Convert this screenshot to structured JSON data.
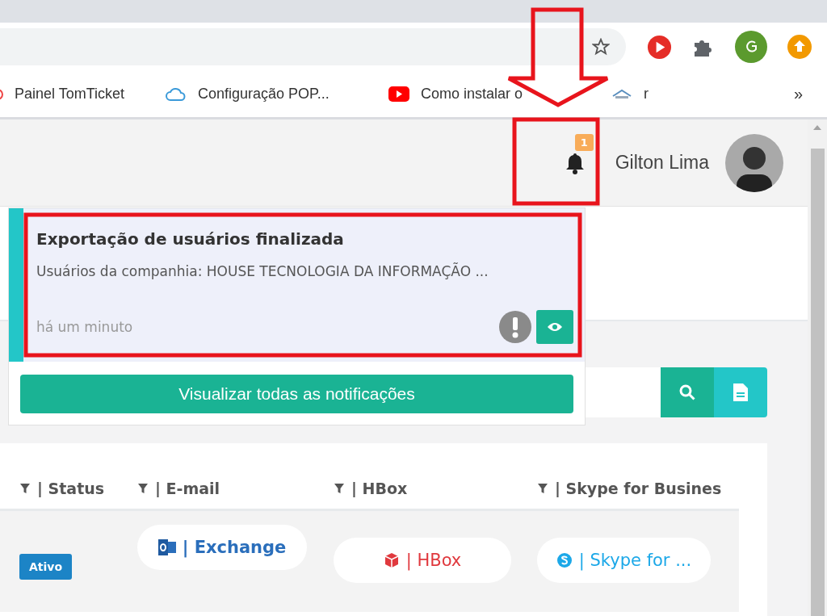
{
  "browser": {
    "bookmarks": [
      {
        "label": "Painel TomTicket"
      },
      {
        "label": "Configuração POP..."
      },
      {
        "label": "Como instalar o"
      },
      {
        "label": "r"
      }
    ],
    "overflow": "»"
  },
  "header": {
    "notification_count": "1",
    "user_name": "Gilton Lima"
  },
  "notifications": [
    {
      "title": "Exportação de usuários finalizada",
      "body": "Usuários da companhia: HOUSE TECNOLOGIA DA INFORMAÇÃO ...",
      "time": "há um minuto"
    }
  ],
  "view_all_button": "Visualizar todas as notificações",
  "table": {
    "columns": [
      "| Status",
      "| E-mail",
      "| HBox",
      "| Skype for Busines"
    ],
    "rows": [
      {
        "status": "Ativo",
        "email": "| Exchange",
        "hbox": "| HBox",
        "skype": "| Skype for ..."
      }
    ]
  }
}
